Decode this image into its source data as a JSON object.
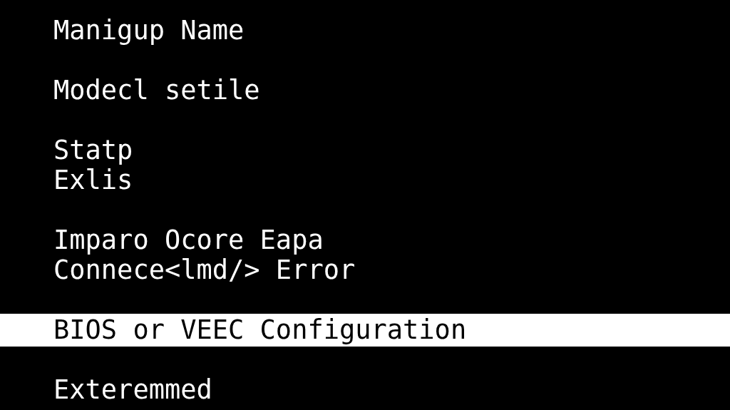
{
  "menu": {
    "groups": [
      {
        "items": [
          {
            "label": "Manigup Name",
            "selected": false
          }
        ]
      },
      {
        "items": [
          {
            "label": "Modecl setile",
            "selected": false
          }
        ]
      },
      {
        "items": [
          {
            "label": "Statp",
            "selected": false
          },
          {
            "label": "Exlis",
            "selected": false
          }
        ]
      },
      {
        "items": [
          {
            "label": "Imparo Ocore Eapa",
            "selected": false
          },
          {
            "label": "Connece<lmd/> Error",
            "selected": false
          }
        ]
      },
      {
        "items": [
          {
            "label": "BIOS or VEEC Configuration",
            "selected": true
          }
        ]
      },
      {
        "items": [
          {
            "label": "Exteremmed",
            "selected": false
          }
        ]
      }
    ]
  }
}
